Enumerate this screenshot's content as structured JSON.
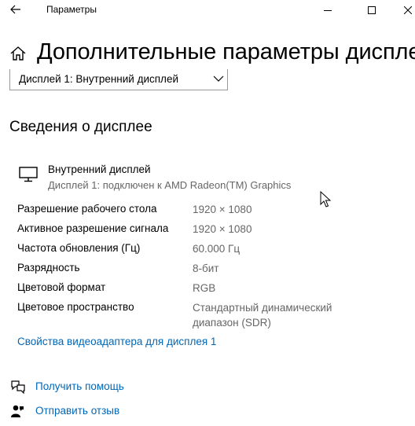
{
  "window": {
    "title": "Параметры",
    "back_icon": "arrow-left-icon",
    "minimize_icon": "minimize-icon",
    "maximize_icon": "maximize-icon",
    "close_icon": "close-icon"
  },
  "page": {
    "title": "Дополнительные параметры дисплея",
    "home_icon": "home-icon"
  },
  "display_select": {
    "selected": "Дисплей 1: Внутренний дисплей"
  },
  "display_info": {
    "heading": "Сведения о дисплее",
    "icon": "monitor-icon",
    "name": "Внутренний дисплей",
    "subtitle": "Дисплей 1: подключен к AMD Radeon(TM) Graphics",
    "properties": [
      {
        "label": "Разрешение рабочего стола",
        "value": "1920 × 1080"
      },
      {
        "label": "Активное разрешение сигнала",
        "value": "1920 × 1080"
      },
      {
        "label": "Частота обновления (Гц)",
        "value": "60.000 Гц"
      },
      {
        "label": "Разрядность",
        "value": "8-бит"
      },
      {
        "label": "Цветовой формат",
        "value": "RGB"
      },
      {
        "label": "Цветовое пространство",
        "value": "Стандартный динамический диапазон (SDR)"
      }
    ],
    "adapter_link": "Свойства видеоадаптера для дисплея 1"
  },
  "footer": {
    "help_link": "Получить помощь",
    "feedback_link": "Отправить отзыв"
  },
  "colors": {
    "link": "#0067b8",
    "secondary_text": "#666666"
  }
}
